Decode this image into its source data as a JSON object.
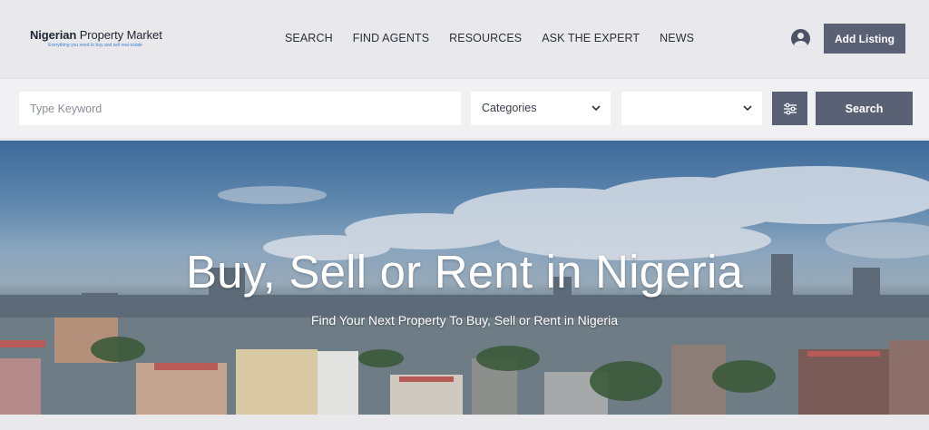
{
  "header": {
    "logo_bold": "Nigerian",
    "logo_rest": " Property Market",
    "logo_tagline": "Everything you need to buy and sell real estate",
    "nav": [
      "SEARCH",
      "FIND AGENTS",
      "RESOURCES",
      "ASK THE EXPERT",
      "NEWS"
    ],
    "add_listing_label": "Add Listing"
  },
  "search": {
    "keyword_placeholder": "Type Keyword",
    "keyword_value": "",
    "categories_label": "Categories",
    "location_label": "",
    "search_label": "Search"
  },
  "hero": {
    "title": "Buy, Sell or Rent in Nigeria",
    "subtitle": "Find Your Next Property To Buy, Sell or Rent in Nigeria"
  },
  "colors": {
    "button_bg": "#5b6175",
    "header_bg": "#e9e9ec",
    "tagline": "#3b7fd6"
  },
  "icons": {
    "user": "user-circle-icon",
    "filter": "sliders-icon",
    "chevron": "chevron-down-icon"
  }
}
